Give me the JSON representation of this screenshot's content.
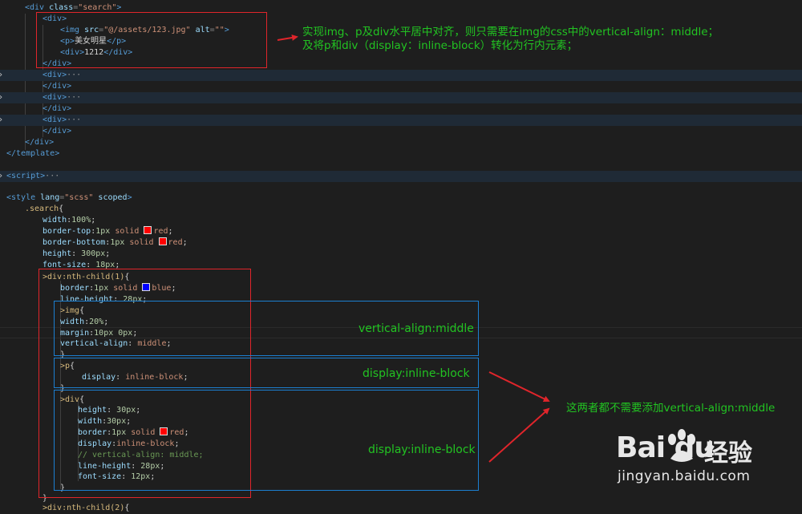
{
  "colors": {
    "annotation_green": "#22c322",
    "box_red": "#e0252b",
    "box_blue": "#1c7fd1",
    "editor_bg": "#1e1e1e"
  },
  "lines": [
    [
      {
        "t": "tag",
        "v": "<div "
      },
      {
        "t": "attr",
        "v": "class"
      },
      {
        "t": "punc",
        "v": "="
      },
      {
        "t": "str",
        "v": "\"search\""
      },
      {
        "t": "tag",
        "v": ">"
      }
    ],
    [
      {
        "t": "tag",
        "v": "<div>"
      }
    ],
    [
      {
        "t": "tag",
        "v": "<img "
      },
      {
        "t": "attr",
        "v": "src"
      },
      {
        "t": "punc",
        "v": "="
      },
      {
        "t": "str",
        "v": "\"@/assets/123.jpg\""
      },
      {
        "t": "attr",
        "v": " alt"
      },
      {
        "t": "punc",
        "v": "="
      },
      {
        "t": "str",
        "v": "\"\""
      },
      {
        "t": "tag",
        "v": ">"
      }
    ],
    [
      {
        "t": "tag",
        "v": "<p>"
      },
      {
        "t": "txt",
        "v": "美女明星"
      },
      {
        "t": "tag",
        "v": "</p>"
      }
    ],
    [
      {
        "t": "tag",
        "v": "<div>"
      },
      {
        "t": "txt",
        "v": "1212"
      },
      {
        "t": "tag",
        "v": "</div>"
      }
    ],
    [
      {
        "t": "tag",
        "v": "</div>"
      }
    ],
    [
      {
        "t": "tag",
        "v": "<div>"
      },
      {
        "t": "fold",
        "v": "···"
      }
    ],
    [
      {
        "t": "tag",
        "v": "</div>"
      }
    ],
    [
      {
        "t": "tag",
        "v": "<div>"
      },
      {
        "t": "fold",
        "v": "···"
      }
    ],
    [
      {
        "t": "tag",
        "v": "</div>"
      }
    ],
    [
      {
        "t": "tag",
        "v": "<div>"
      },
      {
        "t": "fold",
        "v": "···"
      }
    ],
    [
      {
        "t": "tag",
        "v": "</div>"
      }
    ],
    [
      {
        "t": "tag",
        "v": "</div>"
      }
    ],
    [
      {
        "t": "tag",
        "v": "</template>"
      }
    ],
    [],
    [
      {
        "t": "tag",
        "v": "<script>"
      },
      {
        "t": "fold",
        "v": "···"
      }
    ],
    [],
    [
      {
        "t": "tag",
        "v": "<style "
      },
      {
        "t": "attr",
        "v": "lang"
      },
      {
        "t": "punc",
        "v": "="
      },
      {
        "t": "str",
        "v": "\"scss\""
      },
      {
        "t": "attr",
        "v": " scoped"
      },
      {
        "t": "tag",
        "v": ">"
      }
    ],
    [
      {
        "t": "sel",
        "v": ".search"
      },
      {
        "t": "txt",
        "v": "{"
      }
    ],
    [
      {
        "t": "prop",
        "v": "width"
      },
      {
        "t": "txt",
        "v": ":"
      },
      {
        "t": "num",
        "v": "100%"
      },
      {
        "t": "txt",
        "v": ";"
      }
    ],
    [
      {
        "t": "prop",
        "v": "border-top"
      },
      {
        "t": "txt",
        "v": ":"
      },
      {
        "t": "num",
        "v": "1px "
      },
      {
        "t": "val",
        "v": "solid "
      },
      {
        "t": "swatch",
        "v": "#ff0000"
      },
      {
        "t": "val",
        "v": "red"
      },
      {
        "t": "txt",
        "v": ";"
      }
    ],
    [
      {
        "t": "prop",
        "v": "border-bottom"
      },
      {
        "t": "txt",
        "v": ":"
      },
      {
        "t": "num",
        "v": "1px "
      },
      {
        "t": "val",
        "v": "solid "
      },
      {
        "t": "swatch",
        "v": "#ff0000"
      },
      {
        "t": "val",
        "v": "red"
      },
      {
        "t": "txt",
        "v": ";"
      }
    ],
    [
      {
        "t": "prop",
        "v": "height"
      },
      {
        "t": "txt",
        "v": ": "
      },
      {
        "t": "num",
        "v": "300px"
      },
      {
        "t": "txt",
        "v": ";"
      }
    ],
    [
      {
        "t": "prop",
        "v": "font-size"
      },
      {
        "t": "txt",
        "v": ": "
      },
      {
        "t": "num",
        "v": "18px"
      },
      {
        "t": "txt",
        "v": ";"
      }
    ],
    [
      {
        "t": "sel",
        "v": ">div:nth-child(1)"
      },
      {
        "t": "txt",
        "v": "{"
      }
    ],
    [
      {
        "t": "prop",
        "v": "border"
      },
      {
        "t": "txt",
        "v": ":"
      },
      {
        "t": "num",
        "v": "1px "
      },
      {
        "t": "val",
        "v": "solid "
      },
      {
        "t": "swatch",
        "v": "#0000ff"
      },
      {
        "t": "val",
        "v": "blue"
      },
      {
        "t": "txt",
        "v": ";"
      }
    ],
    [
      {
        "t": "prop",
        "v": "line-height"
      },
      {
        "t": "txt",
        "v": ": "
      },
      {
        "t": "num",
        "v": "28px"
      },
      {
        "t": "txt",
        "v": ";"
      }
    ],
    [
      {
        "t": "sel",
        "v": ">img"
      },
      {
        "t": "txt",
        "v": "{"
      }
    ],
    [
      {
        "t": "prop",
        "v": "width"
      },
      {
        "t": "txt",
        "v": ":"
      },
      {
        "t": "num",
        "v": "20%"
      },
      {
        "t": "txt",
        "v": ";"
      }
    ],
    [
      {
        "t": "prop",
        "v": "margin"
      },
      {
        "t": "txt",
        "v": ":"
      },
      {
        "t": "num",
        "v": "10px 0px"
      },
      {
        "t": "txt",
        "v": ";"
      }
    ],
    [
      {
        "t": "prop",
        "v": "vertical-align"
      },
      {
        "t": "txt",
        "v": ": "
      },
      {
        "t": "val",
        "v": "middle"
      },
      {
        "t": "txt",
        "v": ";"
      }
    ],
    [
      {
        "t": "txt",
        "v": "}"
      }
    ],
    [
      {
        "t": "sel",
        "v": ">p"
      },
      {
        "t": "txt",
        "v": "{"
      }
    ],
    [
      {
        "t": "prop",
        "v": "display"
      },
      {
        "t": "txt",
        "v": ": "
      },
      {
        "t": "val",
        "v": "inline-block"
      },
      {
        "t": "txt",
        "v": ";"
      }
    ],
    [
      {
        "t": "txt",
        "v": "}"
      }
    ],
    [
      {
        "t": "sel",
        "v": ">div"
      },
      {
        "t": "txt",
        "v": "{"
      }
    ],
    [
      {
        "t": "prop",
        "v": "height"
      },
      {
        "t": "txt",
        "v": ": "
      },
      {
        "t": "num",
        "v": "30px"
      },
      {
        "t": "txt",
        "v": ";"
      }
    ],
    [
      {
        "t": "prop",
        "v": "width"
      },
      {
        "t": "txt",
        "v": ":"
      },
      {
        "t": "num",
        "v": "30px"
      },
      {
        "t": "txt",
        "v": ";"
      }
    ],
    [
      {
        "t": "prop",
        "v": "border"
      },
      {
        "t": "txt",
        "v": ":"
      },
      {
        "t": "num",
        "v": "1px "
      },
      {
        "t": "val",
        "v": "solid "
      },
      {
        "t": "swatch",
        "v": "#ff0000"
      },
      {
        "t": "val",
        "v": "red"
      },
      {
        "t": "txt",
        "v": ";"
      }
    ],
    [
      {
        "t": "prop",
        "v": "display"
      },
      {
        "t": "txt",
        "v": ":"
      },
      {
        "t": "val",
        "v": "inline-block"
      },
      {
        "t": "txt",
        "v": ";"
      }
    ],
    [
      {
        "t": "comment",
        "v": "// vertical-align: middle;"
      }
    ],
    [
      {
        "t": "prop",
        "v": "line-height"
      },
      {
        "t": "txt",
        "v": ": "
      },
      {
        "t": "num",
        "v": "28px"
      },
      {
        "t": "txt",
        "v": ";"
      }
    ],
    [
      {
        "t": "prop",
        "v": "font-size"
      },
      {
        "t": "txt",
        "v": ": "
      },
      {
        "t": "num",
        "v": "12px"
      },
      {
        "t": "txt",
        "v": ";"
      }
    ],
    [
      {
        "t": "txt",
        "v": "}"
      }
    ],
    [
      {
        "t": "txt",
        "v": "}"
      }
    ],
    [
      {
        "t": "sel",
        "v": ">div:nth-child(2)"
      },
      {
        "t": "txt",
        "v": "{"
      }
    ]
  ],
  "annotations": {
    "note_html_line1": "实现img、p及div水平居中对齐，则只需要在img的css中的vertical-align：middle；",
    "note_html_line2": "及将p和div（display：inline-block）转化为行内元素；",
    "label_img": "vertical-align:middle",
    "label_p": "display:inline-block",
    "label_div": "display:inline-block",
    "note_right": "这两者都不需要添加vertical-align:middle"
  },
  "watermark": {
    "logo": "Bai du",
    "cn": "经验",
    "url": "jingyan.baidu.com"
  }
}
